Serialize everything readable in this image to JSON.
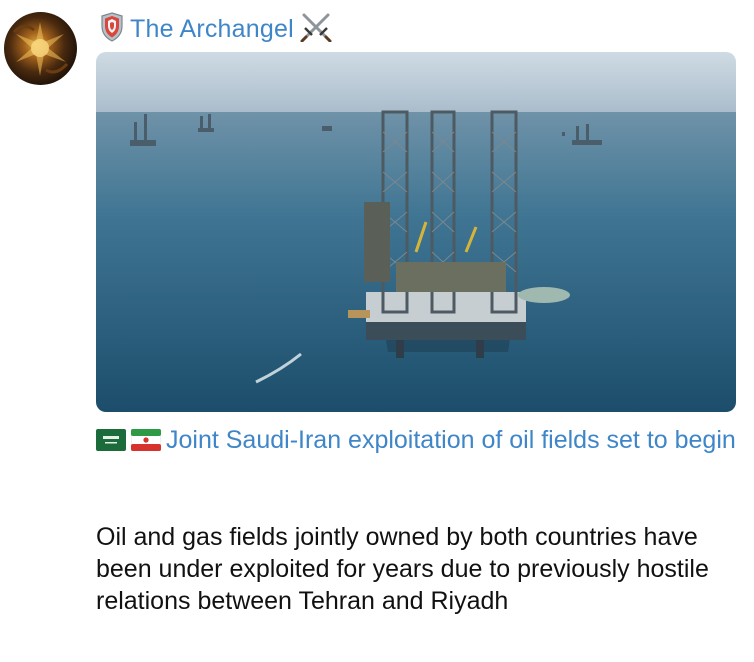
{
  "channel": {
    "name": "The Archangel",
    "leading_icon": "shield-emoji-icon",
    "trailing_icon": "crossed-swords-icon"
  },
  "avatar": {
    "icon": "channel-avatar"
  },
  "media": {
    "description_icon": "offshore-oil-rig-photo"
  },
  "headline": {
    "flags": [
      "saudi-flag-icon",
      "iran-flag-icon"
    ],
    "text": "Joint Saudi-Iran exploitation of oil fields set to begin"
  },
  "body": {
    "text": "Oil and gas fields jointly owned by both countries have been under exploited for years due to previously hostile relations between Tehran and Riyadh"
  },
  "colors": {
    "link": "#3f86c9",
    "text": "#111111",
    "background": "#ffffff"
  }
}
